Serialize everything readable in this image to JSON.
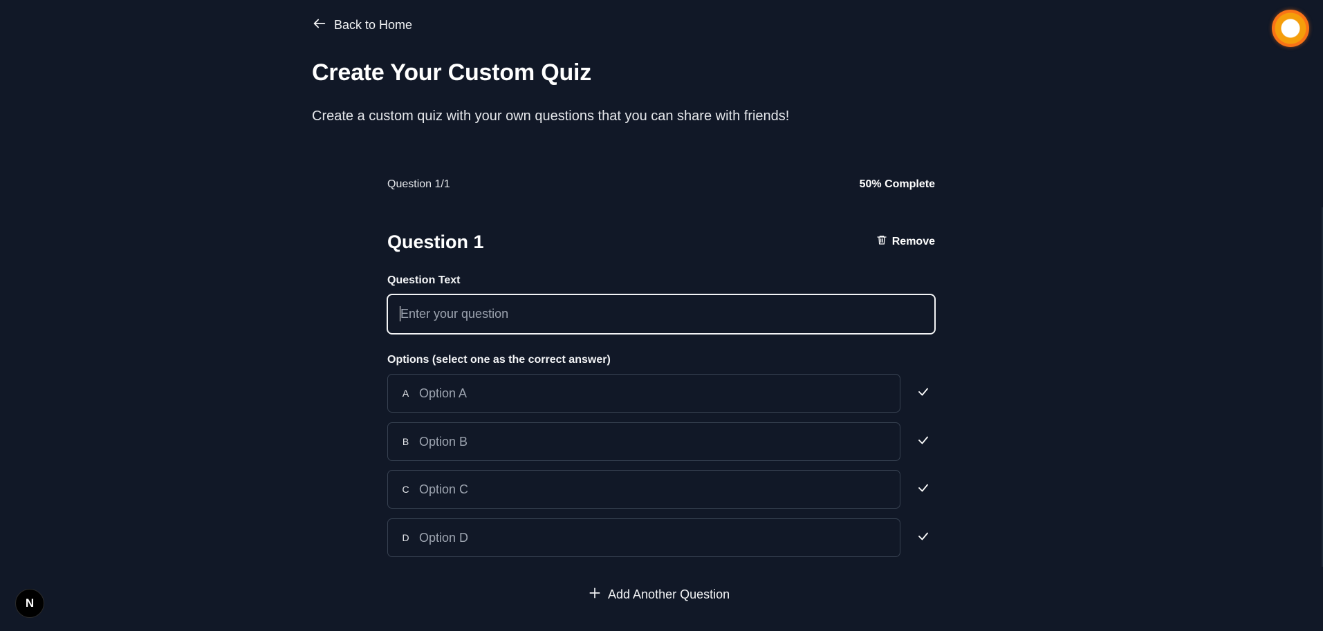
{
  "nav": {
    "back_label": "Back to Home"
  },
  "header": {
    "title": "Create Your Custom Quiz",
    "subtitle": "Create a custom quiz with your own questions that you can share with friends!"
  },
  "progress": {
    "label": "Question 1/1",
    "percent_label": "50% Complete",
    "percent": 50
  },
  "question": {
    "heading": "Question 1",
    "remove_label": "Remove",
    "text_label": "Question Text",
    "text_placeholder": "Enter your question",
    "text_value": "",
    "options_label": "Options (select one as the correct answer)",
    "options": [
      {
        "letter": "A",
        "placeholder": "Option A",
        "value": ""
      },
      {
        "letter": "B",
        "placeholder": "Option B",
        "value": ""
      },
      {
        "letter": "C",
        "placeholder": "Option C",
        "value": ""
      },
      {
        "letter": "D",
        "placeholder": "Option D",
        "value": ""
      }
    ]
  },
  "actions": {
    "add_question_label": "Add Another Question"
  },
  "badges": {
    "framework_letter": "N"
  },
  "colors": {
    "background": "#111827",
    "accent_orange": "#f97316",
    "text": "#ffffff",
    "muted": "#9ca3af",
    "border": "#374151"
  }
}
